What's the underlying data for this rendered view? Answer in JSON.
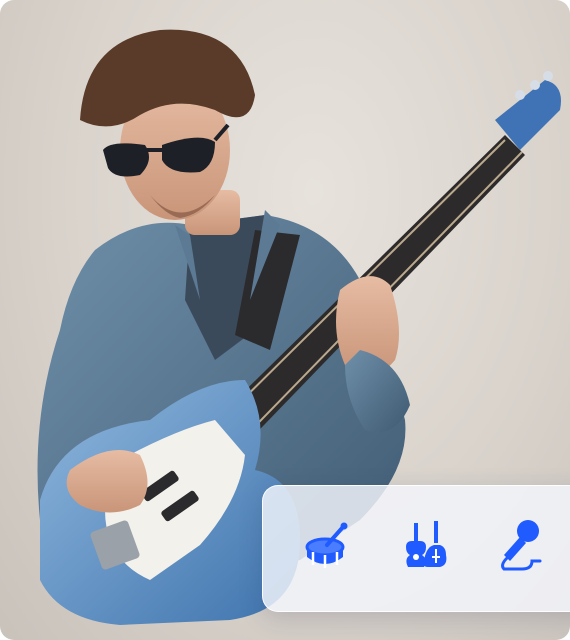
{
  "hero": {
    "image_icon": "musician-playing-electric-guitar-photo"
  },
  "instrument_bar": {
    "accent_color": "#1f5bff",
    "items": [
      {
        "icon": "drum-icon"
      },
      {
        "icon": "guitars-icon"
      },
      {
        "icon": "microphone-icon"
      }
    ]
  }
}
